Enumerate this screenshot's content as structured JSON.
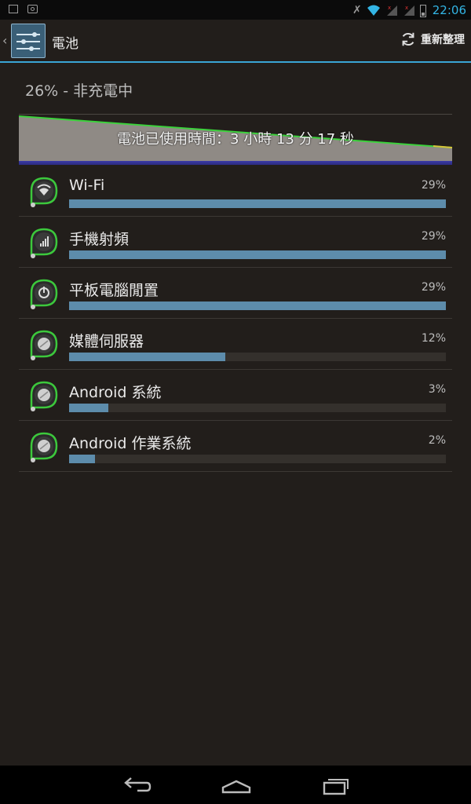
{
  "status_bar": {
    "time": "22:06",
    "icons": [
      "image-icon",
      "screenshot-icon",
      "mute-icon",
      "wifi-icon",
      "signal-icon",
      "signal-icon",
      "battery-icon"
    ]
  },
  "action_bar": {
    "title": "電池",
    "refresh_label": "重新整理",
    "accent_color": "#3aa5d5"
  },
  "battery": {
    "status": "26% - 非充電中",
    "graph_label": "電池已使用時間：3 小時 13 分 17 秒",
    "level": 0.26
  },
  "usage": [
    {
      "name": "Wi-Fi",
      "percent_label": "29%",
      "percent": 29,
      "icon": "wifi-icon"
    },
    {
      "name": "手機射頻",
      "percent_label": "29%",
      "percent": 29,
      "icon": "cell-signal-icon"
    },
    {
      "name": "平板電腦閒置",
      "percent_label": "29%",
      "percent": 29,
      "icon": "power-icon"
    },
    {
      "name": "媒體伺服器",
      "percent_label": "12%",
      "percent": 12,
      "icon": "app-icon"
    },
    {
      "name": "Android 系統",
      "percent_label": "3%",
      "percent": 3,
      "icon": "app-icon"
    },
    {
      "name": "Android 作業系統",
      "percent_label": "2%",
      "percent": 2,
      "icon": "app-icon"
    }
  ],
  "nav": {
    "buttons": [
      "back-icon",
      "home-icon",
      "recents-icon"
    ]
  }
}
